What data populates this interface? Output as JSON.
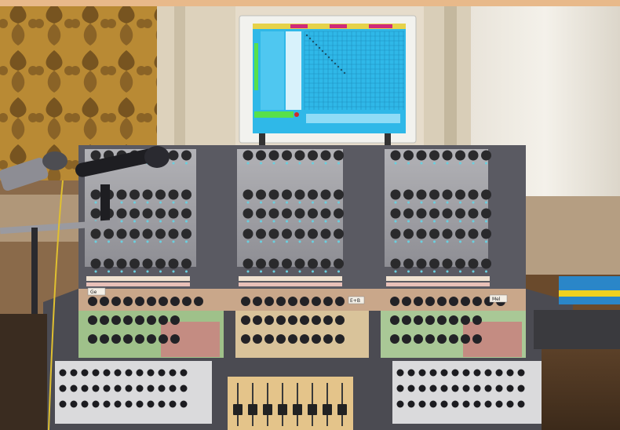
{
  "scene": {
    "description_free": true,
    "colors": {
      "wallpaper_gold": "#b8862e",
      "wallpaper_dark": "#6a4a1e",
      "wall_cream": "#e8dcc6",
      "console_grey": "#a8a8a8",
      "console_dark": "#5a5a60",
      "panel_tan": "#c9a780",
      "panel_pink": "#c48c82",
      "monitor_screen": "#35c6f0",
      "monitor_bezel": "#f2f2ee",
      "knob_black": "#2a2a2c",
      "button_green": "#9fc98a",
      "button_red": "#e05050"
    }
  },
  "labels": {
    "tag_left": "Ge",
    "tag_center": "E+B",
    "tag_right": "Mel"
  },
  "monitor": {
    "status_color": "#30d030"
  }
}
